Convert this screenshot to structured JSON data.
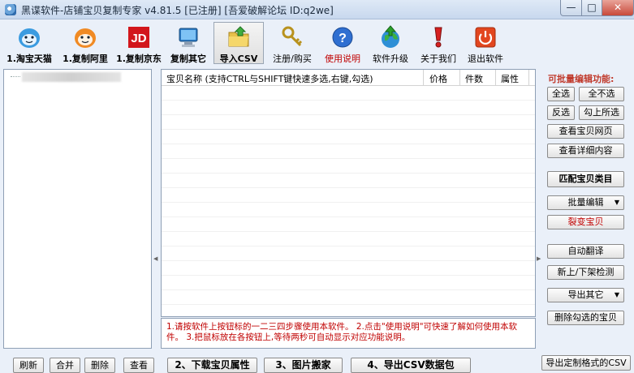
{
  "window": {
    "title": "黑谍软件-店铺宝贝复制专家  v4.81.5 [已注册] [吾爱破解论坛 ID:q2we]",
    "minimize": "—",
    "maximize": "□",
    "close": "✕"
  },
  "toolbar": {
    "items": [
      {
        "label": "1.淘宝天猫",
        "icon": "taobao-icon"
      },
      {
        "label": "1.复制阿里",
        "icon": "alibaba-icon"
      },
      {
        "label": "1.复制京东",
        "icon": "jd-icon"
      },
      {
        "label": "复制其它",
        "icon": "computer-icon"
      },
      {
        "label": "导入CSV",
        "icon": "import-folder-icon"
      },
      {
        "label": "注册/购买",
        "icon": "key-icon"
      },
      {
        "label": "使用说明",
        "icon": "help-icon"
      },
      {
        "label": "软件升级",
        "icon": "globe-upgrade-icon"
      },
      {
        "label": "关于我们",
        "icon": "exclamation-icon"
      },
      {
        "label": "退出软件",
        "icon": "power-icon"
      }
    ]
  },
  "list": {
    "columns": [
      "宝贝名称 (支持CTRL与SHIFT键快速多选,右键,勾选)",
      "价格",
      "件数",
      "属性"
    ]
  },
  "info": {
    "text": "1.请按软件上按钮标的一二三四步骤使用本软件。 2.点击\"使用说明\"可快速了解如何使用本软件。 3.把鼠标放在各按钮上,等待两秒可自动显示对应功能说明。"
  },
  "right_panel": {
    "title": "可批量编辑功能:",
    "select_all": "全选",
    "select_none": "全不选",
    "invert": "反选",
    "select_checked": "勾上所选",
    "view_page": "查看宝贝网页",
    "view_detail": "查看详细内容",
    "match_category": "匹配宝贝类目",
    "batch_edit": "批量编辑",
    "split_item": "裂变宝贝",
    "auto_translate": "自动翻译",
    "listing_check": "新上/下架检测",
    "export_other": "导出其它",
    "delete_checked": "删除勾选的宝贝"
  },
  "bottom": {
    "refresh": "刷新",
    "merge": "合并",
    "delete": "删除",
    "view": "查看",
    "step2": "2、下载宝贝属性",
    "step3": "3、图片搬家",
    "step4": "4、导出CSV数据包",
    "export_custom": "导出定制格式的CSV"
  }
}
